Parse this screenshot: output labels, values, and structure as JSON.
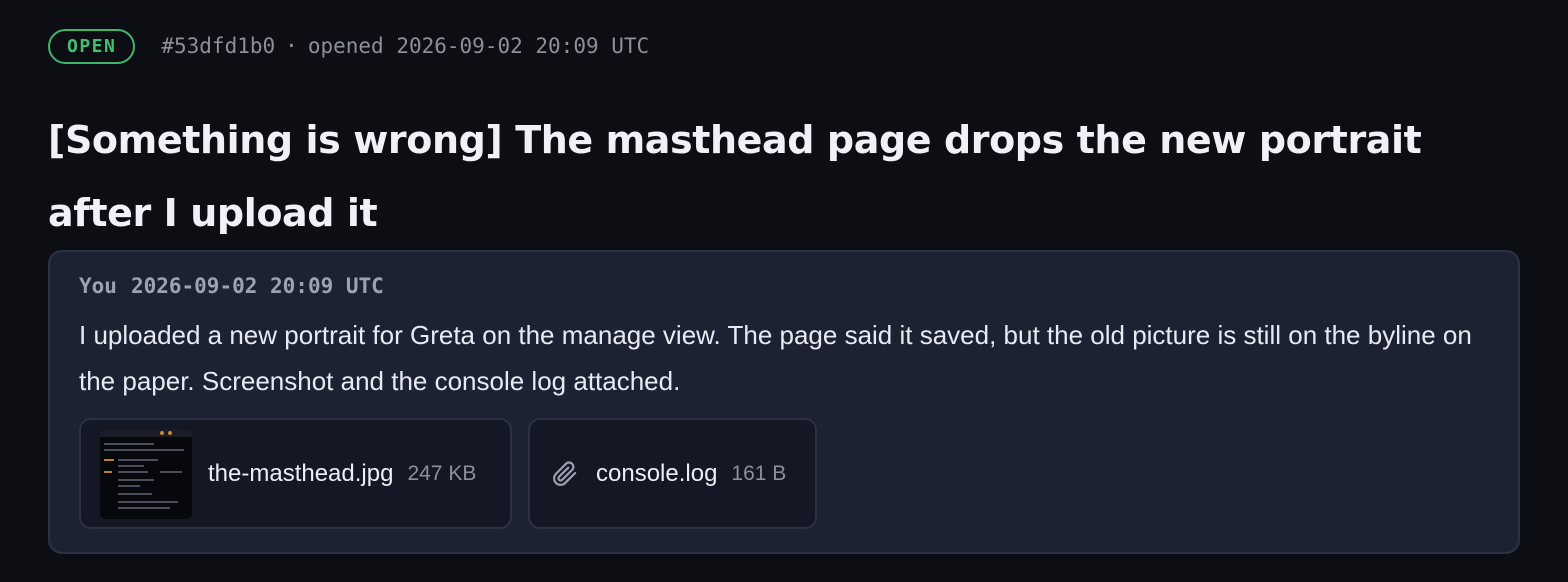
{
  "issue": {
    "status": "OPEN",
    "id": "#53dfd1b0",
    "opened_label": "opened 2026-09-02 20:09 UTC",
    "separator": "·",
    "title": "[Something is wrong] The masthead page drops the new portrait after I upload it"
  },
  "comment": {
    "author": "You",
    "timestamp": "2026-09-02 20:09 UTC",
    "body": "I uploaded a new portrait for Greta on the manage view. The page said it saved, but the old picture is still on the byline on the paper. Screenshot and the console log attached."
  },
  "attachments": [
    {
      "name": "the-masthead.jpg",
      "size": "247 KB",
      "icon": "image-thumbnail"
    },
    {
      "name": "console.log",
      "size": "161 B",
      "icon": "paperclip-icon"
    }
  ],
  "colors": {
    "background": "#0d0e14",
    "card": "#1d2232",
    "status_open": "#3fc171",
    "muted_text": "#8c8f9c"
  }
}
